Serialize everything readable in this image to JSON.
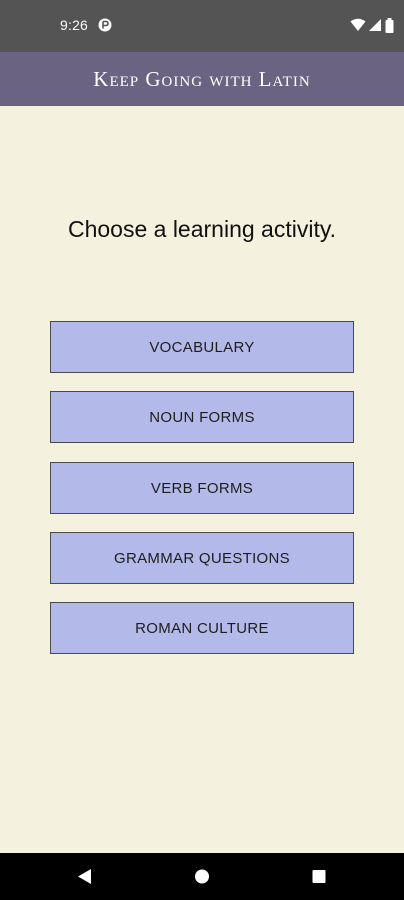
{
  "status_bar": {
    "time": "9:26",
    "app_icon": "notification-app-icon",
    "icons": [
      "wifi-icon",
      "signal-icon",
      "battery-icon"
    ]
  },
  "app_bar": {
    "title": "Keep Going with Latin",
    "background": "#6b6382"
  },
  "main": {
    "prompt": "Choose a learning activity.",
    "background": "#f5f1df",
    "button_color": "#b3b9e8",
    "activities": [
      {
        "label": "VOCABULARY"
      },
      {
        "label": "NOUN FORMS"
      },
      {
        "label": "VERB FORMS"
      },
      {
        "label": "GRAMMAR QUESTIONS"
      },
      {
        "label": "ROMAN CULTURE"
      }
    ]
  },
  "nav_bar": {
    "icons": [
      "back-icon",
      "home-icon",
      "recents-icon"
    ]
  }
}
